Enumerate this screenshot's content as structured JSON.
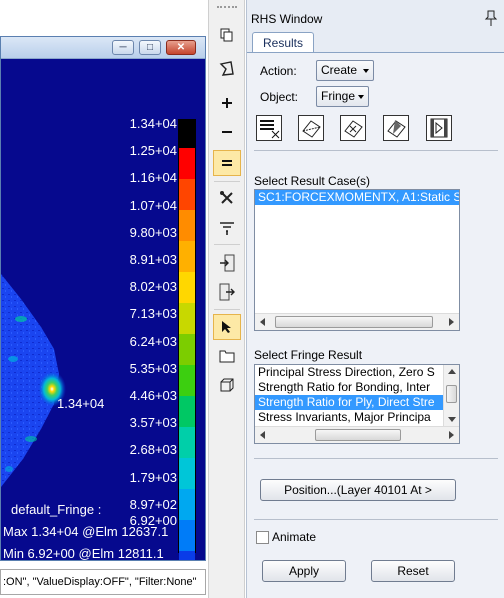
{
  "viewport": {
    "legend": {
      "labels": [
        "1.34+04",
        "1.25+04",
        "1.16+04",
        "1.07+04",
        "9.80+03",
        "8.91+03",
        "8.02+03",
        "7.13+03",
        "6.24+03",
        "5.35+03",
        "4.46+03",
        "3.57+03",
        "2.68+03",
        "1.79+03",
        "8.97+02",
        "6.92+00"
      ],
      "colors": [
        "#000000",
        "#ff0000",
        "#ff4500",
        "#ff8c00",
        "#ffb000",
        "#ffd700",
        "#c8d800",
        "#7ccd00",
        "#3ccf10",
        "#00c864",
        "#00cfa9",
        "#00c6d8",
        "#00a8f0",
        "#007cf8",
        "#0a3ce8",
        "#0a14c8"
      ]
    },
    "peak_label": "1.34+04",
    "fringe_name": "default_Fringe :",
    "max_line": "Max 1.34+04 @Elm 12637.1",
    "min_line": "Min 6.92+00 @Elm 12811.1",
    "command_line": ":ON\", \"ValueDisplay:OFF\", \"Filter:None\""
  },
  "toolbar": {
    "icons": [
      "copy-icon",
      "lasso-icon",
      "plus-icon",
      "minus-icon",
      "equals-icon",
      "cross-tools-icon",
      "filter-icon",
      "import-icon",
      "export-icon",
      "select-arrow-icon",
      "folder-icon",
      "cube-frame-icon"
    ]
  },
  "panel": {
    "title": "RHS Window",
    "tab_label": "Results",
    "action_label": "Action:",
    "action_value": "Create",
    "object_label": "Object:",
    "object_value": "Fringe",
    "result_case_label": "Select Result Case(s)",
    "result_cases": [
      "SC1:FORCEXMOMENTX, A1:Static S"
    ],
    "fringe_result_label": "Select Fringe Result",
    "fringe_results": [
      "Principal Stress Direction, Zero S",
      "Strength Ratio for Bonding, Inter",
      "Strength Ratio for Ply, Direct Stre",
      "Stress Invariants, Major Principa"
    ],
    "position_button": "Position...(Layer 40101 At >",
    "animate_label": "Animate",
    "apply_button": "Apply",
    "reset_button": "Reset"
  },
  "colors": {
    "viewport_bg": "#06098e",
    "selection": "#3399ff",
    "panel_bg": "#e7ecf4"
  }
}
